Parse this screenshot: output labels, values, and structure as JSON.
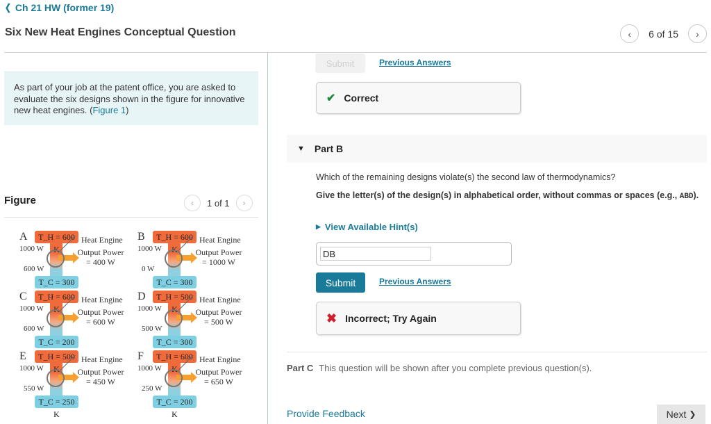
{
  "header": {
    "back_label": "Ch 21 HW (former 19)",
    "title": "Six New Heat Engines Conceptual Question",
    "pager": {
      "text": "6 of 15",
      "prev_icon": "‹",
      "next_icon": "›"
    }
  },
  "intro": {
    "text": "As part of your job at the patent office, you are asked to evaluate the six designs shown in the figure for innovative new heat engines. (",
    "figure_link": "Figure 1",
    "close": ")"
  },
  "figure": {
    "title": "Figure",
    "pager_text": "1 of 1",
    "engines": [
      {
        "letter": "A",
        "th": "T_H = 600 K",
        "tc": "T_C = 300 K",
        "qh": "1000 W",
        "qc": "600 W",
        "label": "Heat Engine",
        "output": "Output Power",
        "output_value": "= 400 W"
      },
      {
        "letter": "B",
        "th": "T_H = 600 K",
        "tc": "T_C = 300 K",
        "qh": "1000 W",
        "qc": "0 W",
        "label": "Heat Engine",
        "output": "Output Power",
        "output_value": "= 1000 W"
      },
      {
        "letter": "C",
        "th": "T_H = 600 K",
        "tc": "T_C = 200 K",
        "qh": "1000 W",
        "qc": "600 W",
        "label": "Heat Engine",
        "output": "Output Power",
        "output_value": "= 600 W"
      },
      {
        "letter": "D",
        "th": "T_H = 500 K",
        "tc": "T_C = 300 K",
        "qh": "1000 W",
        "qc": "500 W",
        "label": "Heat Engine",
        "output": "Output Power",
        "output_value": "= 500 W"
      },
      {
        "letter": "E",
        "th": "T_H = 500 K",
        "tc": "T_C = 250 K",
        "qh": "1000 W",
        "qc": "550 W",
        "label": "Heat Engine",
        "output": "Output Power",
        "output_value": "= 450 W"
      },
      {
        "letter": "F",
        "th": "T_H = 600 K",
        "tc": "T_C = 200 K",
        "qh": "1000 W",
        "qc": "250 W",
        "label": "Heat Engine",
        "output": "Output Power",
        "output_value": "= 650 W"
      }
    ]
  },
  "part_a": {
    "submit_label": "Submit",
    "previous_answers_label": "Previous Answers",
    "result": {
      "icon": "check-icon",
      "glyph": "✔",
      "text": "Correct"
    }
  },
  "part_b": {
    "label": "Part B",
    "question": "Which of the remaining designs violate(s) the second law of thermodynamics?",
    "instruction": "Give the letter(s) of the design(s) in alphabetical order, without commas or spaces (e.g., ",
    "instruction_example": "ABD",
    "instruction_end": ").",
    "hint_label": "View Available Hint(s)",
    "answer_value": "DB",
    "submit_label": "Submit",
    "previous_answers_label": "Previous Answers",
    "result": {
      "icon": "x-icon",
      "glyph": "✖",
      "text": "Incorrect; Try Again"
    }
  },
  "part_c": {
    "label": "Part C",
    "text": "This question will be shown after you complete previous question(s)."
  },
  "footer": {
    "feedback_label": "Provide Feedback",
    "next_label": "Next",
    "next_icon": "❯"
  },
  "colors": {
    "accent": "#1a7a9a",
    "correct": "#1e8a3e",
    "incorrect": "#d0202e",
    "hot_reservoir": "#ef6b3c",
    "cold_reservoir": "#7fcfe3",
    "output_arrow": "#f7a030"
  }
}
